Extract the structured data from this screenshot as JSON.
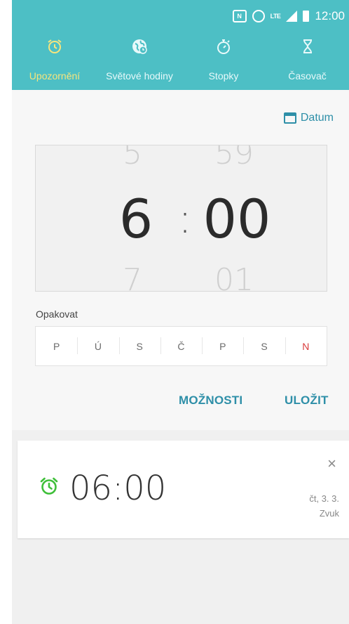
{
  "status_bar": {
    "time": "12:00",
    "network_label": "LTE",
    "nfc_label": "N"
  },
  "tabs": [
    {
      "label": "Upozornění",
      "icon": "alarm-clock-icon",
      "active": true
    },
    {
      "label": "Světové hodiny",
      "icon": "globe-icon",
      "active": false
    },
    {
      "label": "Stopky",
      "icon": "stopwatch-icon",
      "active": false
    },
    {
      "label": "Časovač",
      "icon": "hourglass-icon",
      "active": false
    }
  ],
  "datum_label": "Datum",
  "picker": {
    "hour_prev": "5",
    "hour": "6",
    "hour_next": "7",
    "separator": ":",
    "minute_prev": "59",
    "minute": "00",
    "minute_next": "01"
  },
  "repeat": {
    "label": "Opakovat",
    "days": [
      "P",
      "Ú",
      "S",
      "Č",
      "P",
      "S",
      "N"
    ]
  },
  "actions": {
    "options_label": "MOŽNOSTI",
    "save_label": "ULOŽIT"
  },
  "alarm": {
    "time": "06:00",
    "date": "čt, 3. 3.",
    "sound": "Zvuk",
    "close_symbol": "×"
  },
  "colors": {
    "header": "#4dbfc5",
    "active_tab": "#f6e57d",
    "accent": "#2e8fa8",
    "sunday": "#d93a3a",
    "alarm_icon": "#3fbf3a"
  }
}
